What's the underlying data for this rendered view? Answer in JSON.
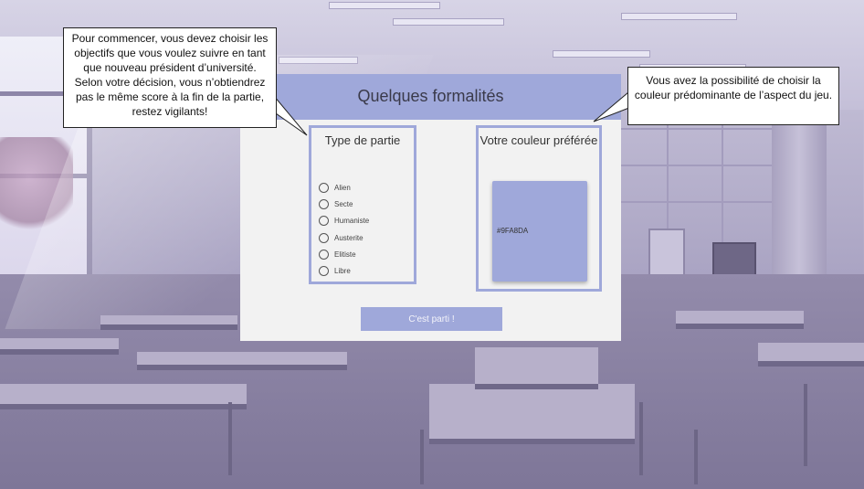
{
  "modal": {
    "title": "Quelques formalités",
    "game_type": {
      "title": "Type de partie",
      "options": [
        "Alien",
        "Secte",
        "Humaniste",
        "Austerite",
        "Elitiste",
        "Libre"
      ]
    },
    "color": {
      "title": "Votre couleur préférée",
      "value": "#9FA8DA"
    },
    "start_label": "C'est parti !"
  },
  "callouts": {
    "left": "Pour commencer, vous devez choisir les objectifs que vous voulez suivre en tant que nouveau président d’université. Selon votre décision, vous n’obtiendrez pas le même score à la fin de la partie, restez vigilants!",
    "right": "Vous avez la possibilité de choisir la couleur prédominante de l’aspect du jeu."
  },
  "colors": {
    "accent": "#9FA8DA",
    "modal_bg": "#F2F2F2"
  }
}
